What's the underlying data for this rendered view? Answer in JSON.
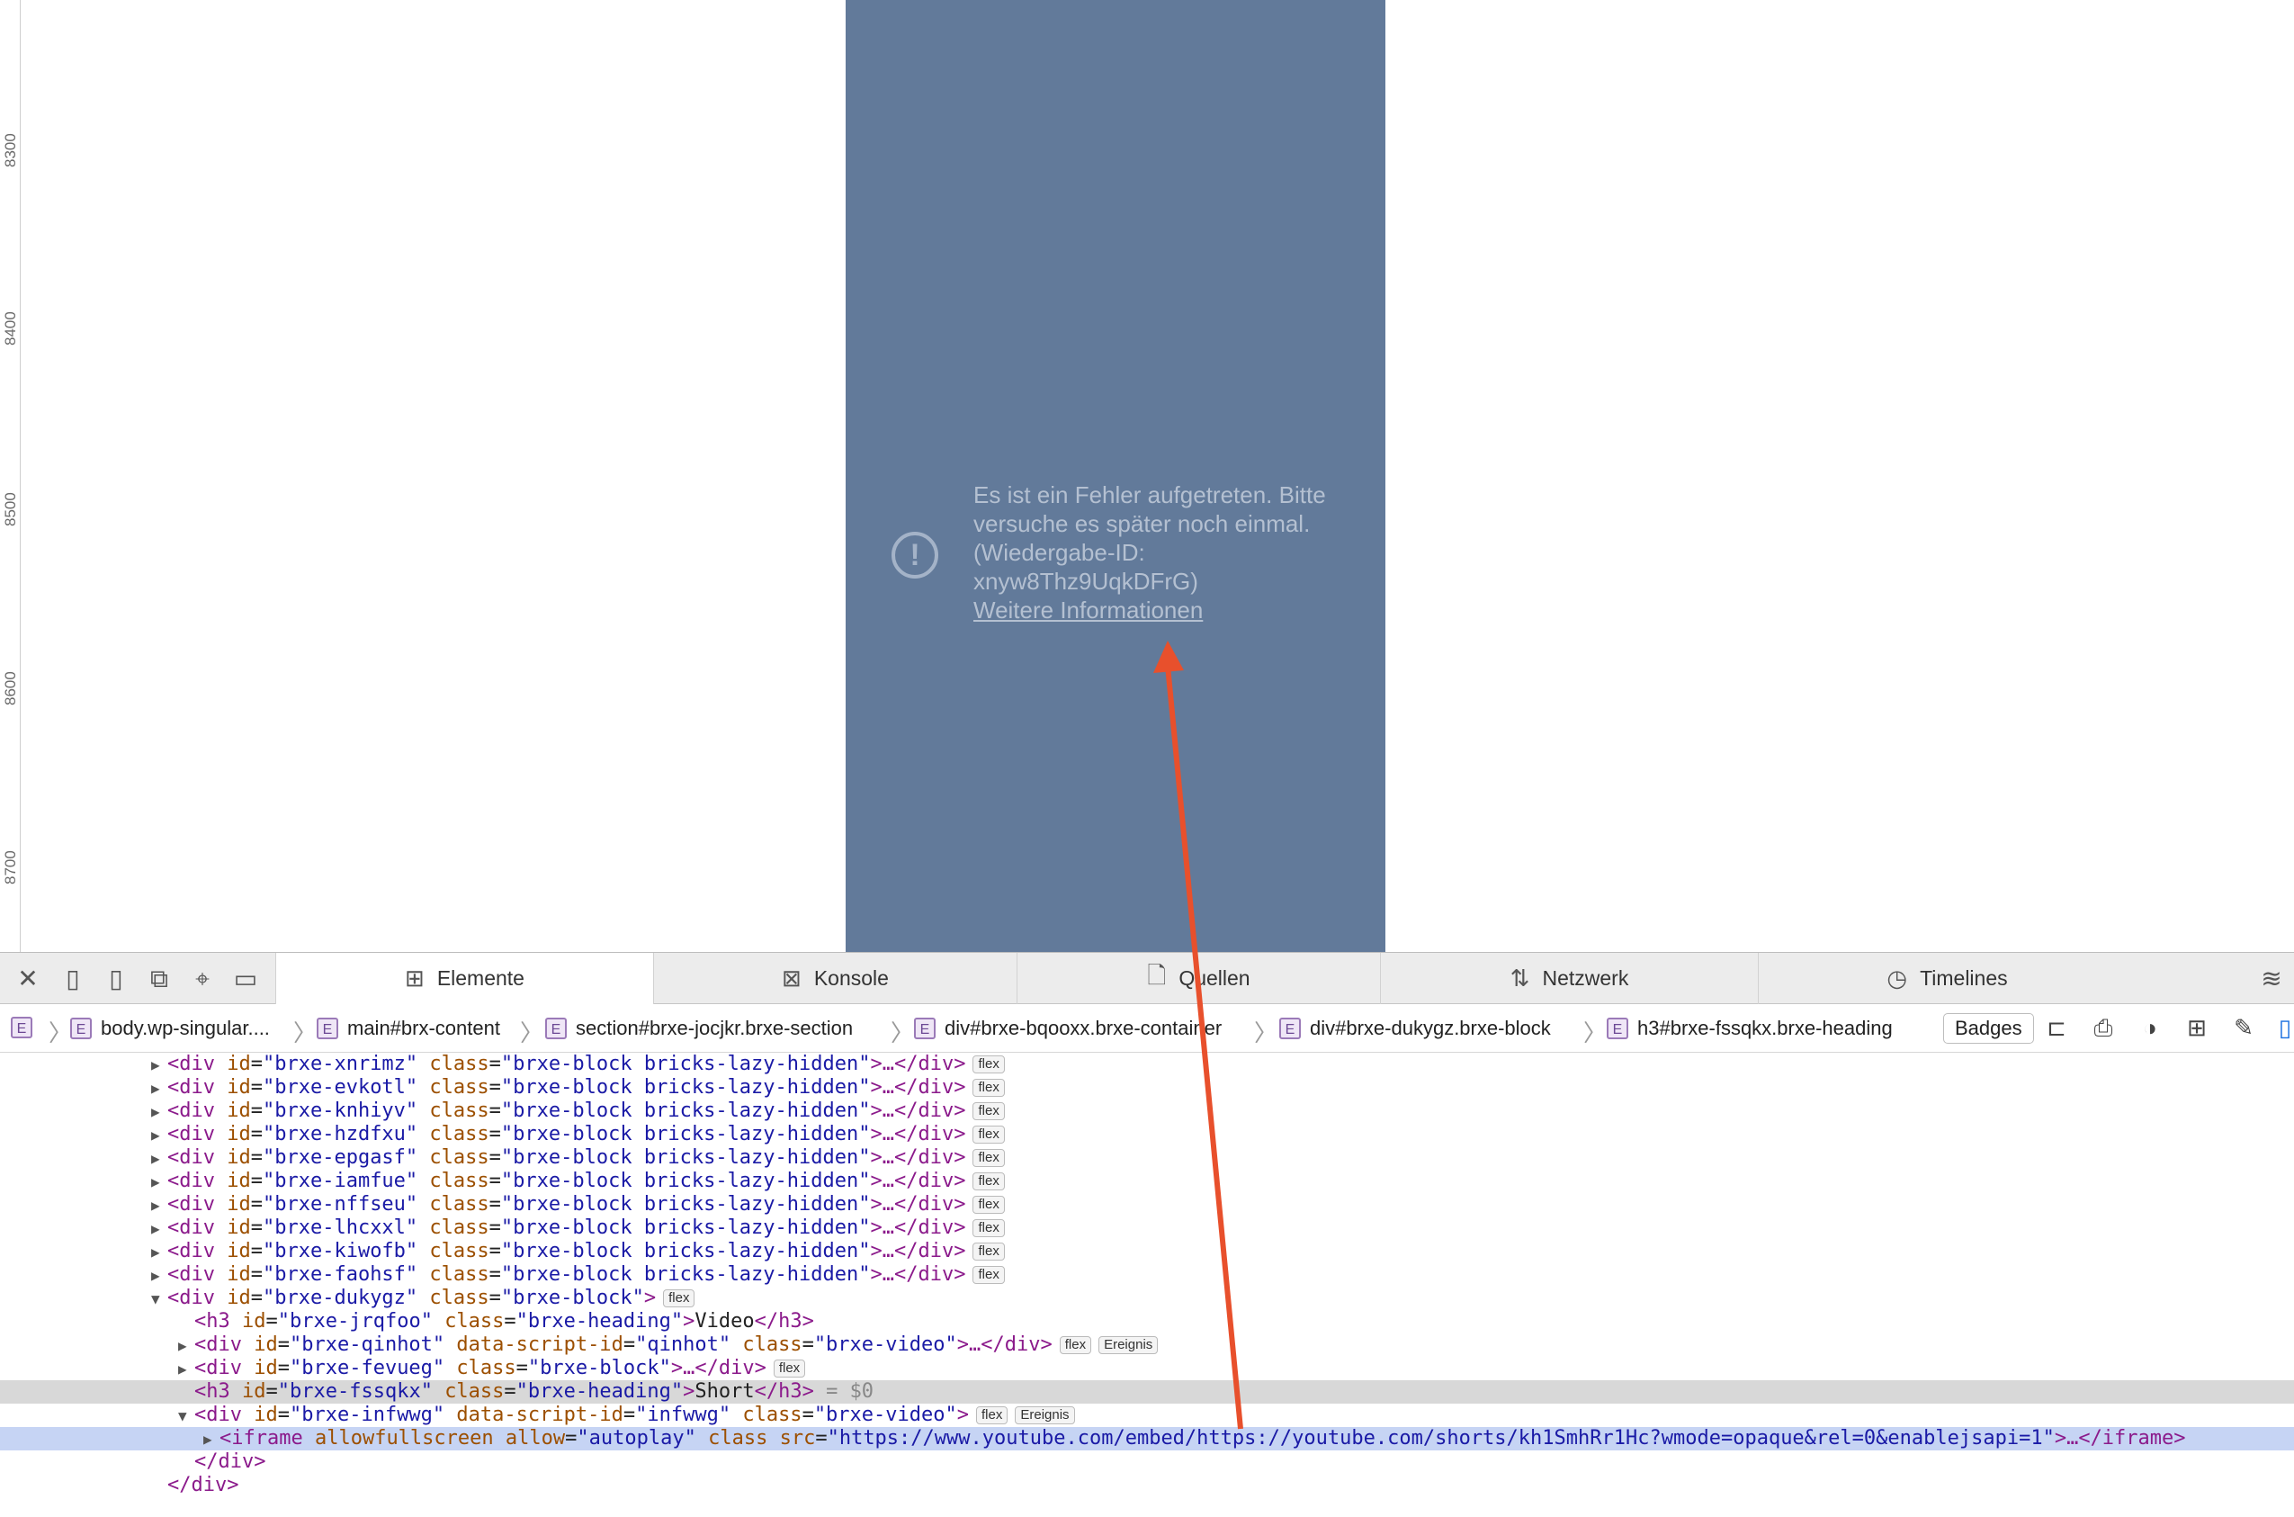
{
  "ruler": {
    "labels": [
      "8300",
      "8400",
      "8500",
      "8600",
      "8700"
    ]
  },
  "video_error": {
    "message": "Es ist ein Fehler aufgetreten. Bitte versuche es später noch einmal. (Wiedergabe-ID: xnyw8Thz9UqkDFrG)",
    "link": "Weitere Informationen"
  },
  "tabs": [
    {
      "label": "Elemente",
      "active": true
    },
    {
      "label": "Konsole"
    },
    {
      "label": "Quellen"
    },
    {
      "label": "Netzwerk"
    },
    {
      "label": "Timelines"
    }
  ],
  "breadcrumbs": [
    "body.wp-singular....",
    "main#brx-content",
    "section#brxe-jocjkr.brxe-section",
    "div#brxe-bqooxx.brxe-container",
    "div#brxe-dukygz.brxe-block",
    "h3#brxe-fssqkx.brxe-heading"
  ],
  "breadcrumb_badge": "E",
  "badges_button": "Badges",
  "dom": {
    "lazy_class": "brxe-block bricks-lazy-hidden",
    "lazy_ids": [
      "brxe-xnrimz",
      "brxe-evkotl",
      "brxe-knhiyv",
      "brxe-hzdfxu",
      "brxe-epgasf",
      "brxe-iamfue",
      "brxe-nffseu",
      "brxe-lhcxxl",
      "brxe-kiwofb",
      "brxe-faohsf"
    ],
    "flex": "flex",
    "event": "Ereignis",
    "block_id": "brxe-dukygz",
    "block_class": "brxe-block",
    "h3_video_id": "brxe-jrqfoo",
    "heading_class": "brxe-heading",
    "h3_video_text": "Video",
    "video1_id": "brxe-qinhot",
    "video1_script": "qinhot",
    "video_class": "brxe-video",
    "block2_id": "brxe-fevueg",
    "h3_short_id": "brxe-fssqkx",
    "h3_short_text": "Short",
    "dollar_zero": "= $0",
    "video2_id": "brxe-infwwg",
    "video2_script": "infwwg",
    "iframe_allow": "autoplay",
    "iframe_src": "https://www.youtube.com/embed/https://youtube.com/shorts/kh1SmhRr1Hc?wmode=opaque&rel=0&enablejsapi=1"
  }
}
